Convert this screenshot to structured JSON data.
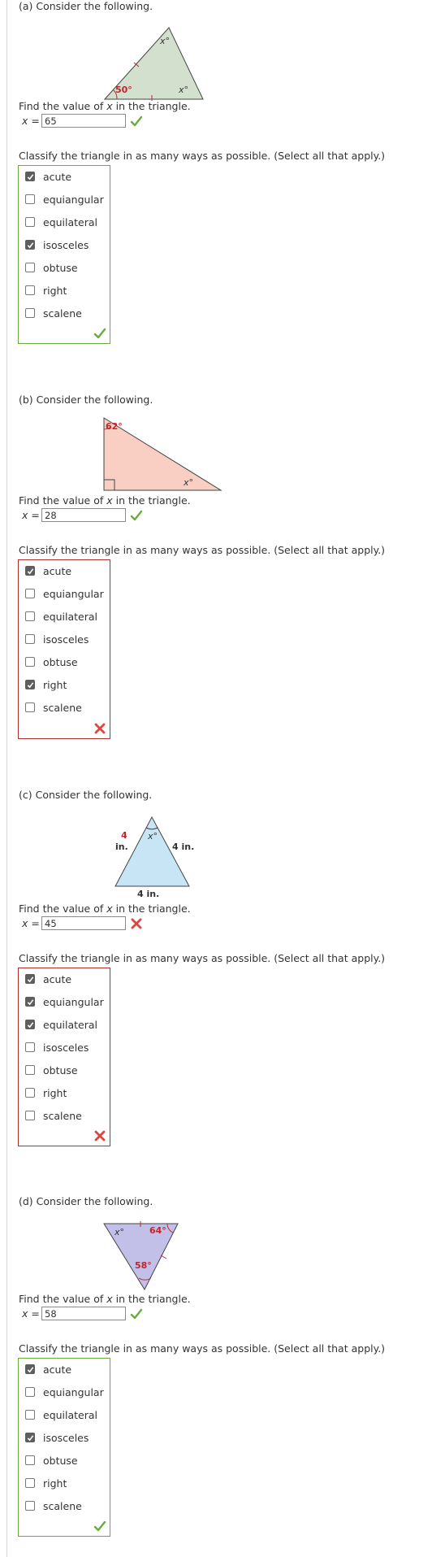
{
  "find_prompt": "Find the value of x in the triangle.",
  "x_label": "x =",
  "classify_prompt": "Classify the triangle in as many ways as possible. (Select all that apply.)",
  "options": [
    "acute",
    "equiangular",
    "equilateral",
    "isosceles",
    "obtuse",
    "right",
    "scalene"
  ],
  "colors": {
    "correct": "#6aab3f",
    "incorrect": "#b03030",
    "label_red": "#c0262d"
  },
  "parts": [
    {
      "title": "(a) Consider the following.",
      "figure": {
        "angle_label": "50°",
        "x_label_1": "x°",
        "x_label_2": "x°"
      },
      "answer": "65",
      "answer_correct": true,
      "checked": [
        true,
        false,
        false,
        true,
        false,
        false,
        false
      ],
      "classify_correct": true
    },
    {
      "title": "(b) Consider the following.",
      "figure": {
        "angle_label": "62°",
        "x_label": "x°"
      },
      "answer": "28",
      "answer_correct": true,
      "checked": [
        true,
        false,
        false,
        false,
        false,
        true,
        false
      ],
      "classify_correct": false
    },
    {
      "title": "(c) Consider the following.",
      "figure": {
        "side_left_num": "4",
        "side_left_unit": "in.",
        "side_right": "4 in.",
        "side_bottom": "4 in.",
        "x_label": "x°"
      },
      "answer": "45",
      "answer_correct": false,
      "checked": [
        true,
        true,
        true,
        false,
        false,
        false,
        false
      ],
      "classify_correct": false
    },
    {
      "title": "(d) Consider the following.",
      "figure": {
        "x_label": "x°",
        "angle_top_right": "64°",
        "angle_bottom": "58°"
      },
      "answer": "58",
      "answer_correct": true,
      "checked": [
        true,
        false,
        false,
        true,
        false,
        false,
        false
      ],
      "classify_correct": true
    }
  ]
}
